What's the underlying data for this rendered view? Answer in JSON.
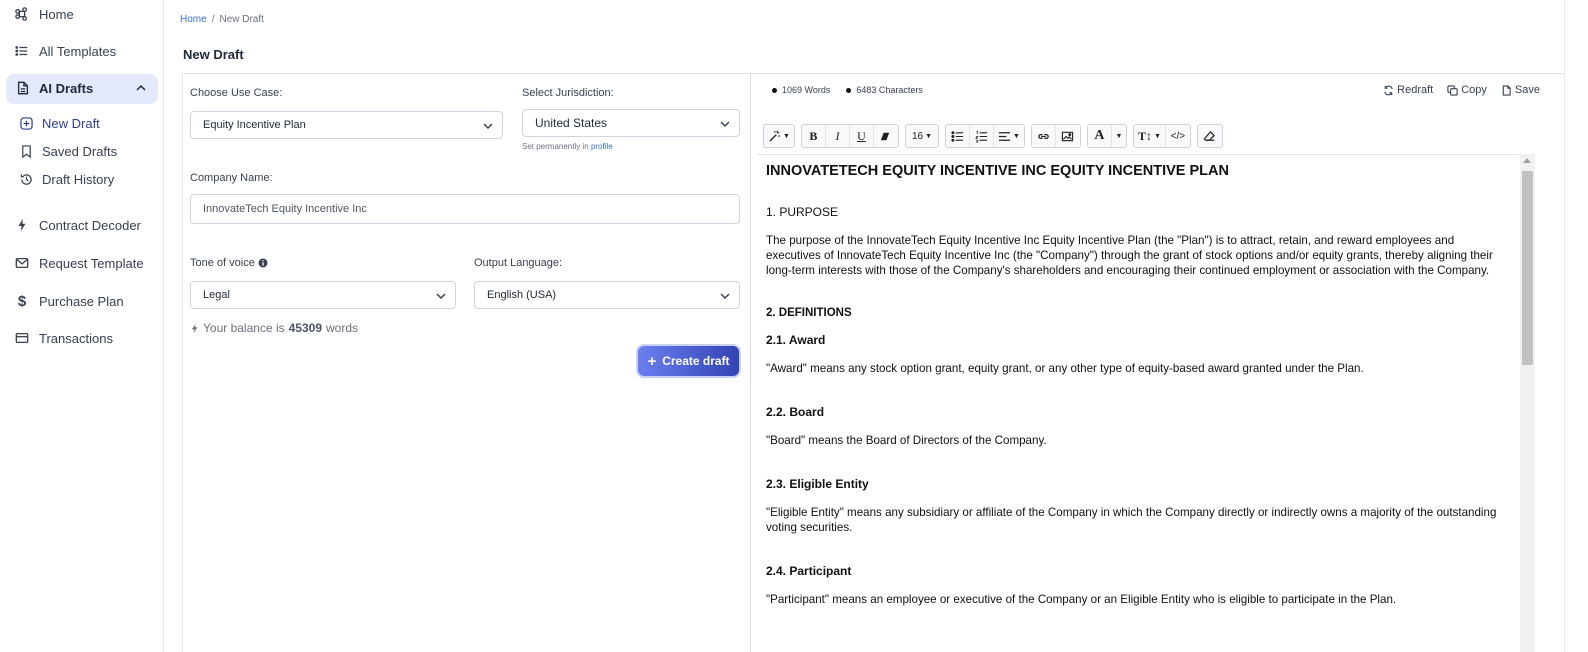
{
  "sidebar": {
    "items": [
      {
        "label": "Home",
        "icon": "command-icon"
      },
      {
        "label": "All Templates",
        "icon": "list-icon"
      },
      {
        "label": "AI Drafts",
        "icon": "document-icon"
      },
      {
        "label": "Contract Decoder",
        "icon": "bolt-icon"
      },
      {
        "label": "Request Template",
        "icon": "mail-icon"
      },
      {
        "label": "Purchase Plan",
        "icon": "dollar-icon"
      },
      {
        "label": "Transactions",
        "icon": "card-icon"
      }
    ],
    "subitems": [
      {
        "label": "New Draft",
        "icon": "plus-square-icon"
      },
      {
        "label": "Saved Drafts",
        "icon": "bookmark-icon"
      },
      {
        "label": "Draft History",
        "icon": "history-icon"
      }
    ]
  },
  "breadcrumb": {
    "home": "Home",
    "separator": "/",
    "current": "New Draft"
  },
  "page_title": "New Draft",
  "form": {
    "use_case_label": "Choose Use Case:",
    "use_case_value": "Equity Incentive Plan",
    "jurisdiction_label": "Select Jurisdiction:",
    "jurisdiction_value": "United States",
    "jurisdiction_hint": "Set permanently in",
    "jurisdiction_hint_link": "profile",
    "company_label": "Company Name:",
    "company_value": "InnovateTech Equity Incentive Inc",
    "tone_label": "Tone of voice",
    "tone_value": "Legal",
    "language_label": "Output Language:",
    "language_value": "English (USA)",
    "balance_prefix": "Your balance is",
    "balance_value": "45309",
    "balance_suffix": "words",
    "create_button": "Create draft"
  },
  "editor": {
    "words": "1069 Words",
    "characters": "6483 Characters",
    "actions": {
      "redraft": "Redraft",
      "copy": "Copy",
      "save": "Save"
    },
    "font_size": "16",
    "document": {
      "title": "INNOVATETECH EQUITY INCENTIVE INC EQUITY INCENTIVE PLAN",
      "s1_heading": "1. PURPOSE",
      "s1_text": "The purpose of the InnovateTech Equity Incentive Inc Equity Incentive Plan (the \"Plan\") is to attract, retain, and reward employees and executives of InnovateTech Equity Incentive Inc (the \"Company\") through the grant of stock options and/or equity grants, thereby aligning their long-term interests with those of the Company's shareholders and encouraging their continued employment or association with the Company.",
      "s2_heading": "2. DEFINITIONS",
      "d1_heading": "2.1. Award",
      "d1_text": "\"Award\" means any stock option grant, equity grant, or any other type of equity-based award granted under the Plan.",
      "d2_heading": "2.2. Board",
      "d2_text": "\"Board\" means the Board of Directors of the Company.",
      "d3_heading": "2.3. Eligible Entity",
      "d3_text": "\"Eligible Entity\" means any subsidiary or affiliate of the Company in which the Company directly or indirectly owns a majority of the outstanding voting securities.",
      "d4_heading": "2.4. Participant",
      "d4_text": "\"Participant\" means an employee or executive of the Company or an Eligible Entity who is eligible to participate in the Plan."
    }
  }
}
